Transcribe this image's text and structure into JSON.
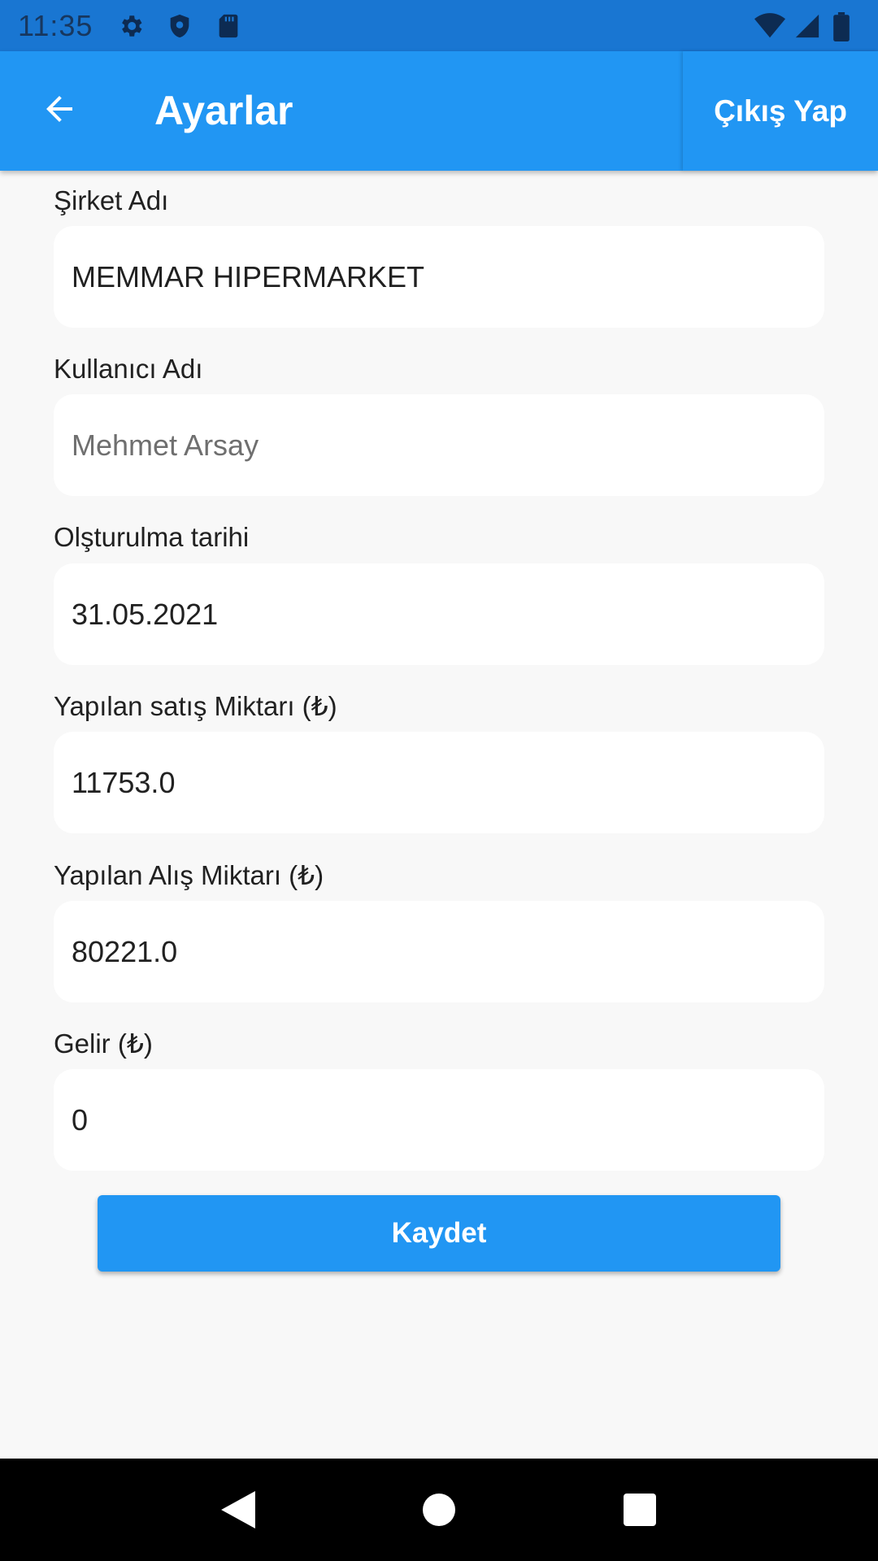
{
  "status_bar": {
    "time": "11:35",
    "icons_left": [
      "gear-icon",
      "shield-icon",
      "sd-card-icon"
    ],
    "icons_right": [
      "wifi-icon",
      "signal-icon",
      "battery-icon"
    ]
  },
  "app_bar": {
    "title": "Ayarlar",
    "back_icon": "arrow-back-icon",
    "logout_label": "Çıkış Yap",
    "color": "#2196f3"
  },
  "form": {
    "company": {
      "label": "Şirket Adı",
      "value": "MEMMAR HIPERMARKET"
    },
    "username": {
      "label": "Kullanıcı Adı",
      "value": "Mehmet Arsay"
    },
    "created": {
      "label": "Olşturulma tarihi",
      "value": "31.05.2021"
    },
    "sales": {
      "label": "Yapılan satış Miktarı (₺)",
      "value": "11753.0"
    },
    "purchases": {
      "label": "Yapılan Alış Miktarı (₺)",
      "value": "80221.0"
    },
    "income": {
      "label": "Gelir (₺)",
      "value": "0"
    }
  },
  "save_label": "Kaydet",
  "nav_bar": {
    "icons": [
      "back-triangle-icon",
      "home-circle-icon",
      "recents-square-icon"
    ]
  }
}
